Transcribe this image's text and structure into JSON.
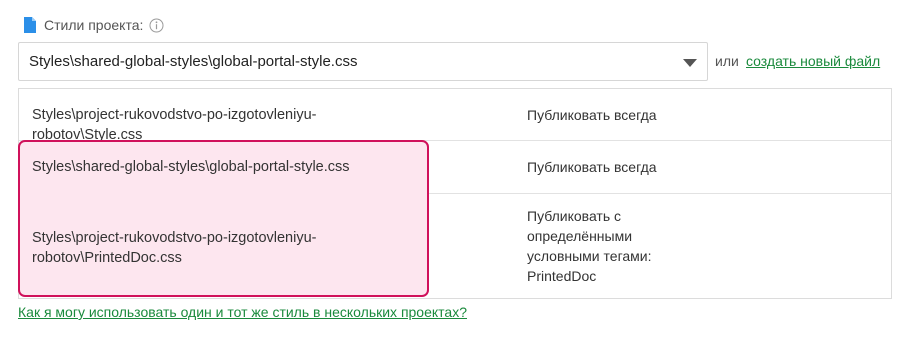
{
  "header": {
    "label": "Стили проекта:",
    "icon": "file-icon",
    "info_icon": "info-icon"
  },
  "select": {
    "value": "Styles\\shared-global-styles\\global-portal-style.css"
  },
  "or_text": "или",
  "create_link": "создать новый файл",
  "rows": [
    {
      "path": "Styles\\project-rukovodstvo-po-izgotovleniyu-robotov\\Style.css",
      "policy": "Публиковать всегда"
    },
    {
      "path": "Styles\\shared-global-styles\\global-portal-style.css",
      "policy": "Публиковать всегда"
    },
    {
      "path": "Styles\\project-rukovodstvo-po-izgotovleniyu-robotov\\PrintedDoc.css",
      "policy": "Публиковать с определёнными условными тегами: PrintedDoc"
    }
  ],
  "help_link": "Как я могу использовать один и тот же стиль в нескольких проектах?",
  "colors": {
    "accent_link": "#1a8a3c",
    "highlight_border": "#d0115b",
    "highlight_fill": "#fde6ef",
    "file_icon": "#2b8fe8"
  }
}
